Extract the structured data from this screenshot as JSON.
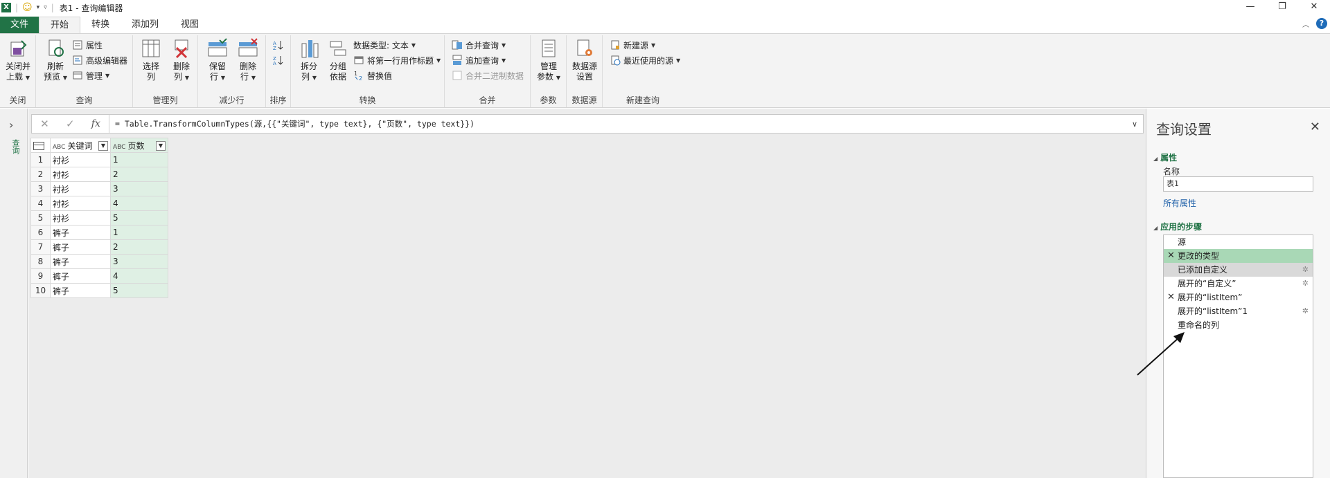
{
  "titlebar": {
    "app_icon": "excel-logo",
    "title": "表1 - 查询编辑器"
  },
  "tabs": [
    {
      "label": "文件"
    },
    {
      "label": "开始"
    },
    {
      "label": "转换"
    },
    {
      "label": "添加列"
    },
    {
      "label": "视图"
    }
  ],
  "ribbon": {
    "close": {
      "btn_l1": "关闭并",
      "btn_l2": "上载",
      "group": "关闭"
    },
    "query": {
      "refresh_l1": "刷新",
      "refresh_l2": "预览",
      "properties": "属性",
      "advanced_editor": "高级编辑器",
      "manage": "管理",
      "group": "查询"
    },
    "manage_cols": {
      "choose_l1": "选择",
      "choose_l2": "列",
      "remove_l1": "删除",
      "remove_l2": "列",
      "group": "管理列"
    },
    "reduce_rows": {
      "keep_l1": "保留",
      "keep_l2": "行",
      "remove_l1": "删除",
      "remove_l2": "行",
      "group": "减少行"
    },
    "sort": {
      "group": "排序"
    },
    "transform": {
      "split_l1": "拆分",
      "split_l2": "列",
      "group_l1": "分组",
      "group_l2": "依据",
      "datatype": "数据类型: 文本",
      "first_row_header": "将第一行用作标题",
      "replace_values": "替换值",
      "group": "转换"
    },
    "combine": {
      "merge_queries": "合并查询",
      "append_queries": "追加查询",
      "combine_binaries": "合并二进制数据",
      "group": "合并"
    },
    "params": {
      "manage_l1": "管理",
      "manage_l2": "参数",
      "group": "参数"
    },
    "datasource": {
      "settings_l1": "数据源",
      "settings_l2": "设置",
      "group": "数据源"
    },
    "newquery": {
      "new_source": "新建源",
      "recent_sources": "最近使用的源",
      "group": "新建查询"
    }
  },
  "leftpane": {
    "label": "查询"
  },
  "formula": {
    "text": "= Table.TransformColumnTypes(源,{{\"关键词\", type text}, {\"页数\", type text}})"
  },
  "grid": {
    "type_abc": "ABC",
    "columns": [
      "关键词",
      "页数"
    ],
    "rows": [
      {
        "n": "1",
        "k": "衬衫",
        "p": "1"
      },
      {
        "n": "2",
        "k": "衬衫",
        "p": "2"
      },
      {
        "n": "3",
        "k": "衬衫",
        "p": "3"
      },
      {
        "n": "4",
        "k": "衬衫",
        "p": "4"
      },
      {
        "n": "5",
        "k": "衬衫",
        "p": "5"
      },
      {
        "n": "6",
        "k": "裤子",
        "p": "1"
      },
      {
        "n": "7",
        "k": "裤子",
        "p": "2"
      },
      {
        "n": "8",
        "k": "裤子",
        "p": "3"
      },
      {
        "n": "9",
        "k": "裤子",
        "p": "4"
      },
      {
        "n": "10",
        "k": "裤子",
        "p": "5"
      }
    ]
  },
  "settings": {
    "title": "查询设置",
    "properties_section": "属性",
    "name_label": "名称",
    "name_value": "表1",
    "all_properties": "所有属性",
    "steps_section": "应用的步骤",
    "steps": [
      {
        "label": "源",
        "x": "",
        "gear": ""
      },
      {
        "label": "更改的类型",
        "x": "✕",
        "gear": ""
      },
      {
        "label": "已添加自定义",
        "x": "",
        "gear": "✲"
      },
      {
        "label": "展开的“自定义”",
        "x": "",
        "gear": "✲"
      },
      {
        "label": "展开的“listItem”",
        "x": "✕",
        "gear": ""
      },
      {
        "label": "展开的“listItem”1",
        "x": "",
        "gear": "✲"
      },
      {
        "label": "重命名的列",
        "x": "",
        "gear": ""
      }
    ]
  },
  "colors": {
    "accent": "#217346",
    "selected_step": "#a9d8b6",
    "selected_col": "#dff0e4"
  }
}
